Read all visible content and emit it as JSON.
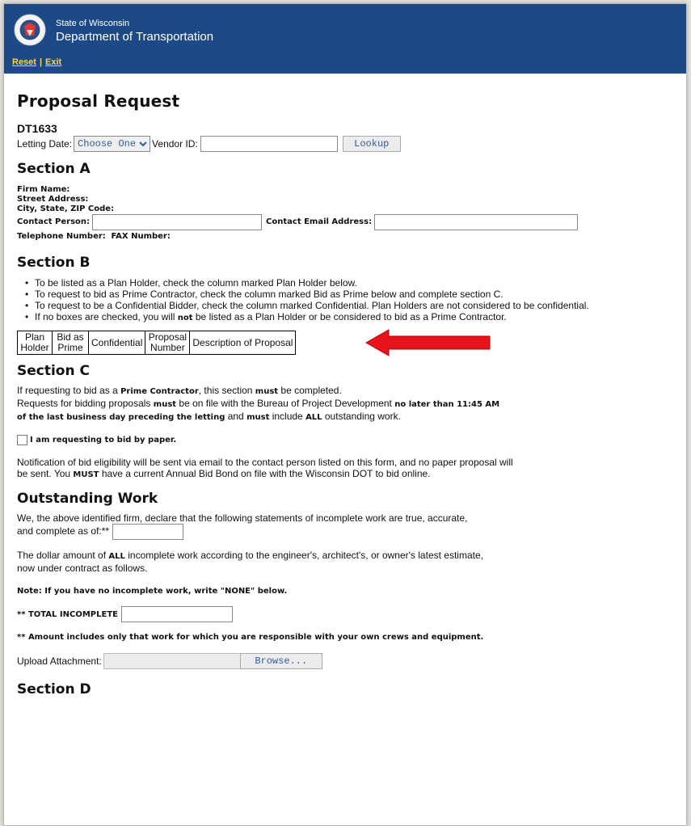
{
  "header": {
    "agency_line1": "State of Wisconsin",
    "agency_line2": "Department of Transportation",
    "reset_link": "Reset",
    "separator": "|",
    "exit_link": "Exit"
  },
  "page_title": "Proposal Request",
  "form_id": "DT1633",
  "letting": {
    "label": "Letting Date:",
    "selected": "Choose One",
    "vendor_label": "Vendor ID:",
    "vendor_value": "",
    "lookup_button": "Lookup"
  },
  "section_a": {
    "title": "Section A",
    "firm_name": "Firm Name:",
    "street": "Street Address:",
    "city": "City, State, ZIP Code:",
    "contact_person": "Contact Person:",
    "contact_email": "Contact Email Address:",
    "telephone": "Telephone Number:",
    "fax": "FAX Number:"
  },
  "section_b": {
    "title": "Section B",
    "bullets": [
      "To be listed as a Plan Holder, check the column marked Plan Holder below.",
      "To request to bid as Prime Contractor, check the column marked Bid as Prime below and complete section C.",
      "To request to be a Confidential Bidder, check the column marked Confidential. Plan Holders are not considered to be confidential.",
      "If no boxes are checked, you will ",
      "not",
      " be listed as a Plan Holder or be considered to bid as a Prime Contractor."
    ],
    "table_headers": [
      "Plan Holder",
      "Bid as Prime",
      "Confidential",
      "Proposal Number",
      "Description of Proposal"
    ],
    "arrow_color": "#e8141b"
  },
  "section_c": {
    "title": "Section C",
    "p1_a": "If requesting to bid as a ",
    "p1_b": "Prime Contractor",
    "p1_c": ", this section ",
    "p1_d": "must",
    "p1_e": " be completed.",
    "p2_a": "Requests for bidding proposals ",
    "p2_b": "must",
    "p2_c": " be on file with the Bureau of Project Development ",
    "p2_d": "no later than 11:45 AM",
    "p3_a": "of the last business day preceding the letting",
    "p3_b": " and ",
    "p3_c": "must",
    "p3_d": " include ",
    "p3_e": "ALL",
    "p3_f": " outstanding work.",
    "paper_checkbox_label": "I am requesting to bid by paper.",
    "notice_a": "Notification of bid eligibility will be sent via email to the contact person listed on this form, and no paper proposal will",
    "notice_b": "be sent. You ",
    "notice_c": "MUST",
    "notice_d": " have a current Annual Bid Bond on file with the Wisconsin DOT to bid online."
  },
  "outstanding": {
    "title": "Outstanding Work",
    "declare_a": "We, the above identified firm, declare that the following statements of incomplete work are true, accurate,",
    "declare_b": "and complete as of:**",
    "dollar_a": "The dollar amount of ",
    "dollar_b": "ALL",
    "dollar_c": " incomplete work according to the engineer's, architect's, or owner's latest estimate,",
    "dollar_d": "now under contract as follows.",
    "note": "Note: If you have no incomplete work, write \"NONE\" below.",
    "total_label": "** TOTAL INCOMPLETE",
    "amount_note": "** Amount includes only that work for which you are responsible with your own crews and equipment.",
    "upload_label": "Upload Attachment:",
    "browse_button": "Browse..."
  },
  "section_d": {
    "title": "Section D"
  }
}
